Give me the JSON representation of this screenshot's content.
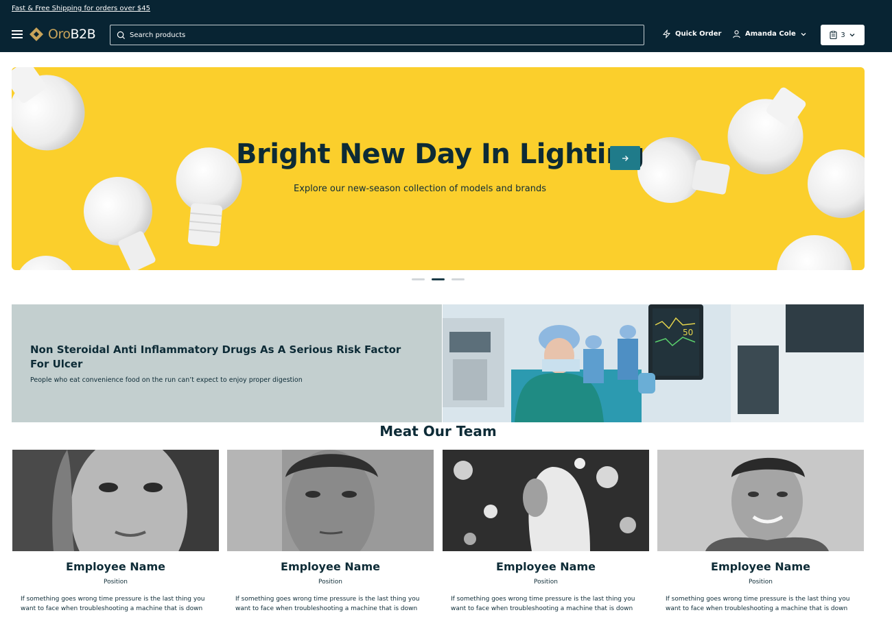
{
  "header": {
    "promo_text": "Fast & Free Shipping for orders over $45",
    "logo_prefix": "Oro",
    "logo_suffix": "B2B",
    "search_placeholder": "Search products",
    "quick_order_label": "Quick Order",
    "user_name": "Amanda Cole",
    "cart_count": "3",
    "icons": {
      "menu": "hamburger-menu-icon",
      "search": "search-icon",
      "quick_order": "lightning-icon",
      "user": "user-icon",
      "cart": "shopping-list-icon",
      "dropdown": "chevron-down-icon"
    }
  },
  "hero": {
    "title": "Bright New Day In Lighting",
    "subtitle": "Explore our new-season collection of models and brands",
    "background_color": "#fbcf2c",
    "button_icon": "arrow-right-icon",
    "slides_total": 3,
    "active_slide": 2
  },
  "banner": {
    "title": "Non Steroidal Anti Inflammatory Drugs As A Serious Risk Factor For Ulcer",
    "subtitle": "People who eat convenience food on the run can’t expect to enjoy proper digestion"
  },
  "team": {
    "title": "Meat Our Team",
    "members": [
      {
        "name": "Employee Name",
        "position": "Position",
        "description": "If something goes wrong time pressure is the last thing you want to face when troubleshooting a machine that is down"
      },
      {
        "name": "Employee Name",
        "position": "Position",
        "description": "If something goes wrong time pressure is the last thing you want to face when troubleshooting a machine that is down"
      },
      {
        "name": "Employee Name",
        "position": "Position",
        "description": "If something goes wrong time pressure is the last thing you want to face when troubleshooting a machine that is down"
      },
      {
        "name": "Employee Name",
        "position": "Position",
        "description": "If something goes wrong time pressure is the last thing you want to face when troubleshooting a machine that is down"
      }
    ]
  },
  "colors": {
    "header_bg": "#082433",
    "accent": "#1f7b8a",
    "banner_bg": "#c3cfcf",
    "text_dark": "#0d2b36"
  }
}
